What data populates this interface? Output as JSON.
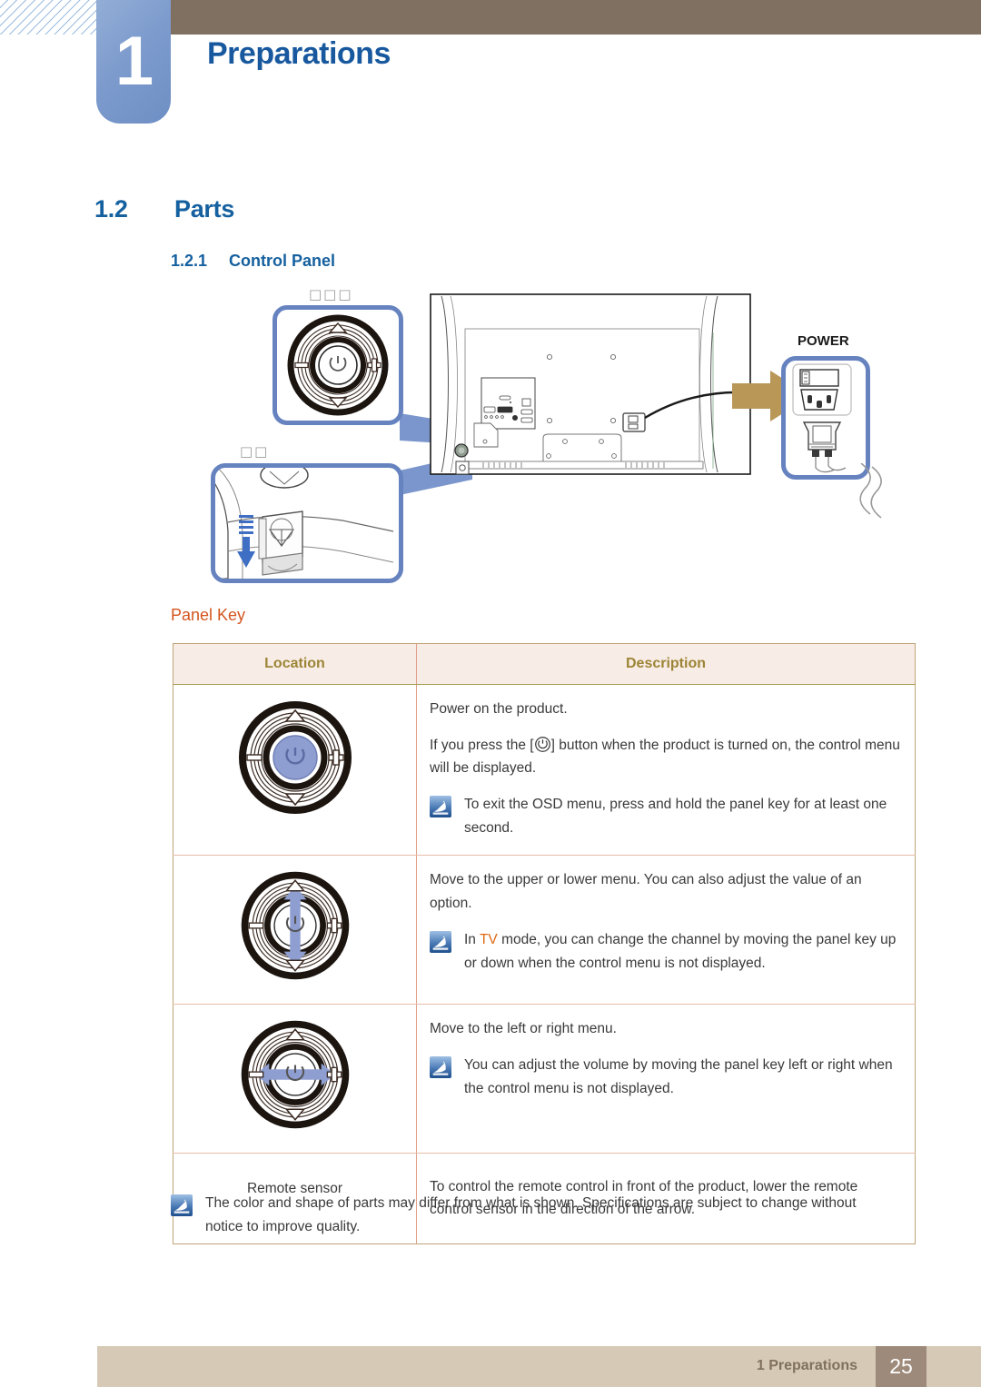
{
  "header": {
    "chapter_number": "1",
    "title": "Preparations"
  },
  "headings": {
    "section_number": "1.2",
    "section_title": "Parts",
    "sub_number": "1.2.1",
    "sub_title": "Control Panel"
  },
  "figure": {
    "callout_top_label": "□□□",
    "callout_bottom_label": "□□",
    "power_label": "POWER"
  },
  "panel_key": {
    "heading": "Panel Key",
    "columns": [
      "Location",
      "Description"
    ],
    "rows": [
      {
        "icon": "joystick-power-icon",
        "location_label": "",
        "paragraphs": [
          "Power on the product.",
          "If you press the [⏻] button when the product is turned on, the control menu will be displayed."
        ],
        "note": "To exit the OSD menu, press and hold the panel key for at least one second."
      },
      {
        "icon": "joystick-up-down-icon",
        "location_label": "",
        "paragraphs": [
          "Move to the upper or lower menu. You can also adjust the value of an option."
        ],
        "note_prefix": "In ",
        "note_highlight": "TV",
        "note_suffix": " mode, you can change the channel by moving the panel key up or down when the control menu is not displayed."
      },
      {
        "icon": "joystick-left-right-icon",
        "location_label": "",
        "paragraphs": [
          "Move to the left or right menu."
        ],
        "note": "You can adjust the volume by moving the panel key left or right when the control menu is not displayed."
      },
      {
        "icon": "",
        "location_label": "Remote sensor",
        "paragraphs": [
          "To control the remote control in front of the product, lower the remote control sensor in the direction of the arrow."
        ],
        "note": ""
      }
    ]
  },
  "bottom_note": "The color and shape of parts may differ from what is shown. Specifications are subject to change without notice to improve quality.",
  "footer": {
    "label": "1 Preparations",
    "page": "25"
  },
  "colors": {
    "heading_blue": "#15609f",
    "badge_blue": "#7d9bcd",
    "header_brown": "#7f7061",
    "panel_key_orange": "#d4551f",
    "table_header_bg": "#f8ece6",
    "table_header_text": "#9c8536",
    "footer_bg": "#d6cab6",
    "footer_page_bg": "#9d8a7b",
    "tv_highlight": "#e06a16",
    "callout_border": "#6683c0",
    "arrow_gold": "#b99757"
  }
}
